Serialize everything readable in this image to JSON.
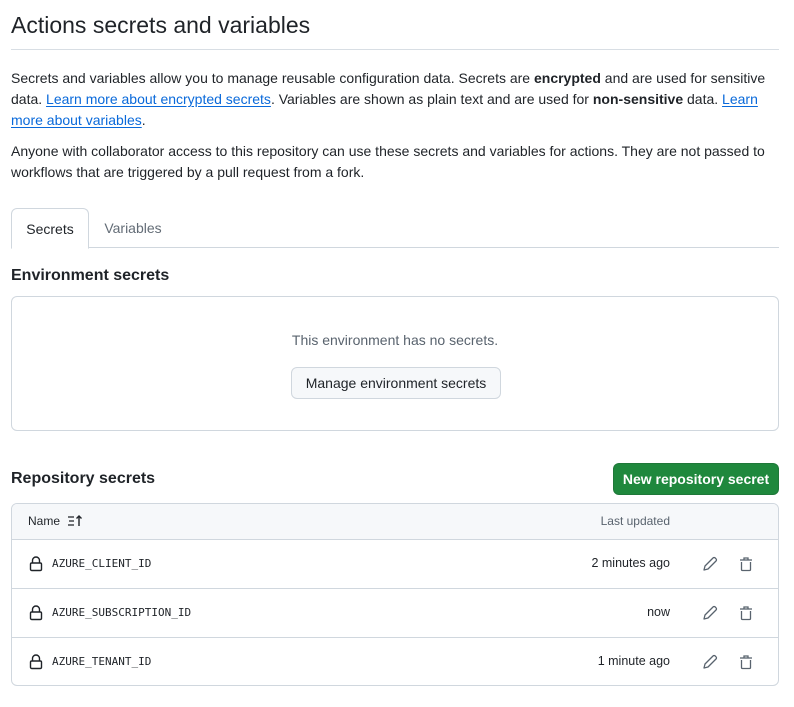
{
  "page": {
    "title": "Actions secrets and variables"
  },
  "intro": {
    "p1_part1": "Secrets and variables allow you to manage reusable configuration data. Secrets are ",
    "p1_bold1": "encrypted",
    "p1_part2": " and are used for sensitive data. ",
    "p1_link1": "Learn more about encrypted secrets",
    "p1_part3": ". Variables are shown as plain text and are used for ",
    "p1_bold2": "non-sensitive",
    "p1_part4": " data. ",
    "p1_link2": "Learn more about variables",
    "p1_part5": ".",
    "p2": "Anyone with collaborator access to this repository can use these secrets and variables for actions. They are not passed to workflows that are triggered by a pull request from a fork."
  },
  "tabs": [
    {
      "label": "Secrets",
      "active": true
    },
    {
      "label": "Variables",
      "active": false
    }
  ],
  "environment_secrets": {
    "heading": "Environment secrets",
    "empty_text": "This environment has no secrets.",
    "manage_button": "Manage environment secrets"
  },
  "repository_secrets": {
    "heading": "Repository secrets",
    "new_button": "New repository secret",
    "columns": {
      "name": "Name",
      "last_updated": "Last updated"
    },
    "rows": [
      {
        "name": "AZURE_CLIENT_ID",
        "updated": "2 minutes ago"
      },
      {
        "name": "AZURE_SUBSCRIPTION_ID",
        "updated": "now"
      },
      {
        "name": "AZURE_TENANT_ID",
        "updated": "1 minute ago"
      }
    ]
  },
  "icons": {
    "lock": "lock-icon",
    "edit": "pencil-icon",
    "delete": "trash-icon",
    "sort": "sort-ascending-icon"
  },
  "colors": {
    "link": "#0969da",
    "primary_button": "#1f883d",
    "border": "#d0d7de"
  }
}
